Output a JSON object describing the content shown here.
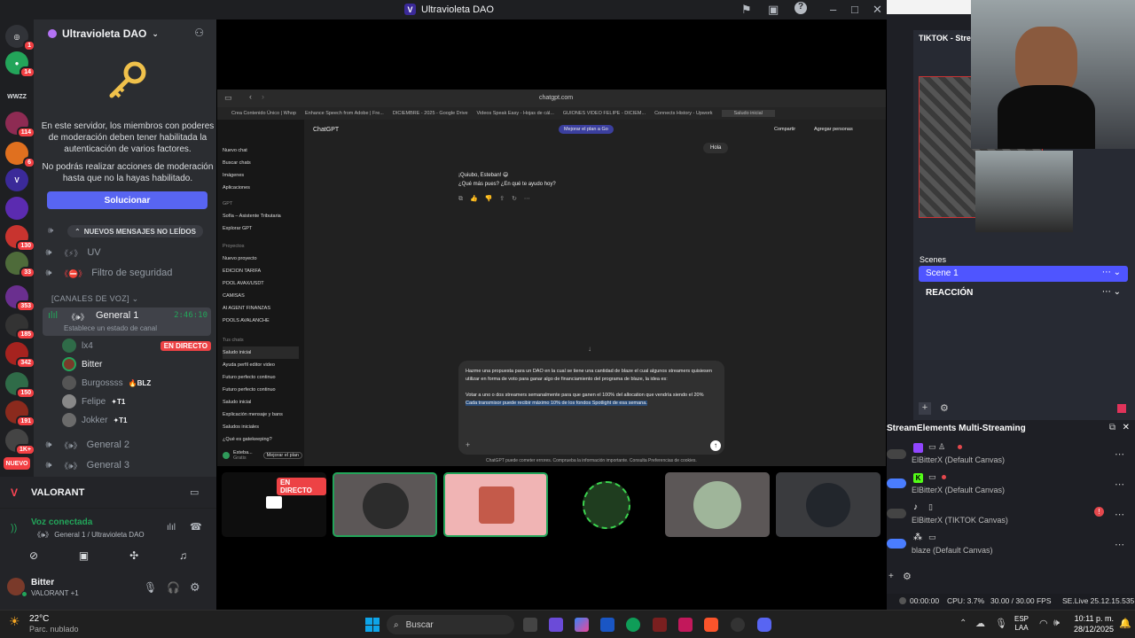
{
  "window": {
    "title": "Ultravioleta DAO",
    "logo_letter": "V"
  },
  "rail": {
    "badges": [
      "1",
      "14",
      "114",
      "6",
      "130",
      "33",
      "353",
      "185",
      "342",
      "150",
      "191",
      "1K+",
      "1K+"
    ],
    "new_label": "NUEVO",
    "wordmark": "WWZZ"
  },
  "server": {
    "name": "Ultravioleta DAO",
    "mfa_text": "En este servidor, los miembros con poderes de moderación deben tener habilitada la autenticación de varios factores.",
    "mfa_text2": "No podrás realizar acciones de moderación hasta que no la hayas habilitado.",
    "fix_button": "Solucionar",
    "unread_pill": "NUEVOS MENSAJES NO LEÍDOS"
  },
  "channels": {
    "uv": "UV",
    "filtro": "Filtro de seguridad",
    "voice_category": "[CANALES DE VOZ]",
    "general1": "General 1",
    "general1_timer": "2:46:10",
    "general1_status": "Establece un estado de canal",
    "general2": "General 2",
    "general3": "General 3"
  },
  "voice_users": [
    {
      "name": "lx4",
      "tag": "",
      "live": "EN DIRECTO"
    },
    {
      "name": "Bitter",
      "tag": "",
      "live": ""
    },
    {
      "name": "Burgossss",
      "tag": "BLZ",
      "live": ""
    },
    {
      "name": "Felipe",
      "tag": "T1",
      "live": ""
    },
    {
      "name": "Jokker",
      "tag": "T1",
      "live": ""
    }
  ],
  "panel": {
    "game": "VALORANT",
    "voice_status": "Voz conectada",
    "voice_channel": "General 1 / Ultravioleta DAO",
    "user_name": "Bitter",
    "user_activity": "VALORANT +1"
  },
  "browser": {
    "url": "chatgpt.com",
    "bookmarks": [
      "Crea Contenido Único | Whop",
      "Enhance Speech from Adobe | Fre...",
      "DICIEMBRE - 2025 - Google Drive",
      "Videos Speak Easy - Hojas de cál...",
      "GUIONES VIDEO FELIPE - DICIEM...",
      "Connects History - Upwork",
      "Saludo inicial"
    ],
    "app_title": "ChatGPT",
    "upgrade": "Mejorar el plan a Go",
    "share": "Compartir",
    "add_people": "Agregar personas",
    "sidebar_top": [
      "Nuevo chat",
      "Buscar chats",
      "Imágenes",
      "Aplicaciones"
    ],
    "gpts_label": "GPT",
    "gpts": [
      "Sofía – Asistente Tributaria",
      "Explorar GPT"
    ],
    "projects_label": "Proyectos",
    "projects": [
      "Nuevo proyecto",
      "EDICION TARIFA",
      "POOL AVAX/USDT",
      "CAMISAS",
      "AI AGENT FINANZAS",
      "POOLS AVALANCHE"
    ],
    "chats_label": "Tus chats",
    "chats": [
      "Saludo inicial",
      "Ayuda perfil editor video",
      "Futuro perfecto continuo",
      "Futuro perfecto continuo",
      "Saludo inicial",
      "Explicación mensaje y bans",
      "Saludos iniciales",
      "¿Qué es gatekeeping?"
    ],
    "account_name": "Esteba...",
    "account_plan": "Gratis",
    "account_upgrade": "Mejorar el plan",
    "user_bubble": "Hola",
    "assistant_line1": "¡Quiubo, Esteban! 😄",
    "assistant_line2": "¿Qué más pues? ¿En qué te ayudo hoy?",
    "composer_text": "Hazme una propuesta para un DAO en la cual se tiene una cantidad de blaze el cual algunos streamers quisiesen utilizar en forma de voto para ganar algo de financiamiento del programa de blaze, la idea es:",
    "composer_text2": "Votar a uno o dos streamers semanalmente para que ganen el 100% del allocation que vendría siendo el 20%",
    "composer_selected": "Cada transmisor puede recibir máximo 10% de los fondos Spotlight de esa semana.",
    "disclaimer": "ChatGPT puede cometer errores. Comprueba la información importante. Consulta Preferencias de cookies."
  },
  "stage": {
    "live_label": "EN DIRECTO"
  },
  "obs": {
    "dock_title": "TIKTOK - Stream",
    "scenes_label": "Scenes",
    "scenes": [
      "Scene 1",
      "REACCIÓN"
    ],
    "multistream_title": "StreamElements Multi-Streaming",
    "outputs": [
      {
        "name": "ElBitterX (Default Canvas)",
        "on": false
      },
      {
        "name": "ElBitterX (Default Canvas)",
        "on": true
      },
      {
        "name": "ElBitterX (TIKTOK Canvas)",
        "on": false
      },
      {
        "name": "blaze (Default Canvas)",
        "on": true
      }
    ],
    "timecode": "00:00:00",
    "cpu": "CPU: 3.7%",
    "fps": "30.00 / 30.00 FPS",
    "version": "SE.Live 25.12.15.535"
  },
  "taskbar": {
    "temp": "22°C",
    "weather": "Parc. nublado",
    "search": "Buscar",
    "lang": "ESP",
    "lang2": "LAA",
    "time": "10:11 p. m.",
    "date": "28/12/2025"
  },
  "colors": {
    "discord_bg": "#2b2d31",
    "blurple": "#5865f2",
    "live_red": "#ed4245",
    "obs_scene_blue": "#4f55ff"
  }
}
